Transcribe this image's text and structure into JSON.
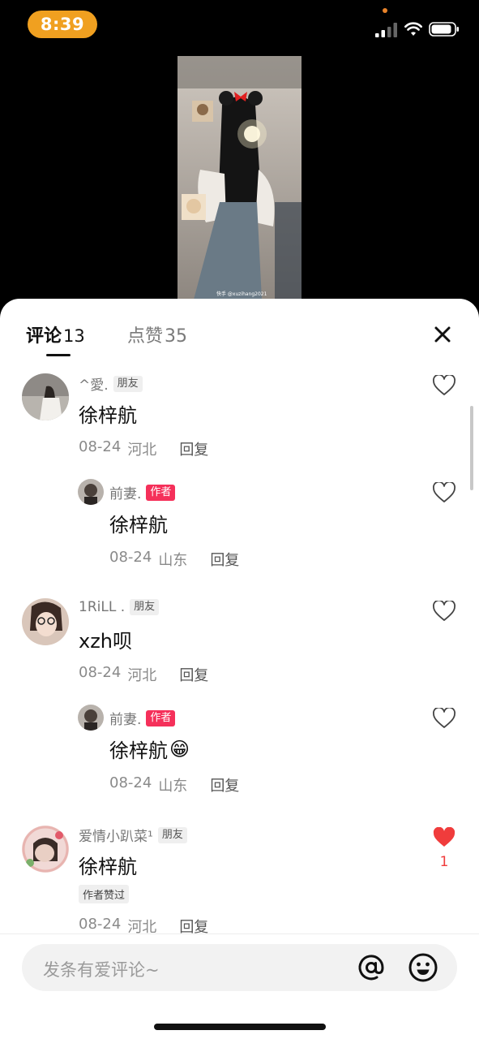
{
  "status_bar": {
    "time": "8:39"
  },
  "video": {
    "watermark": "快手 @xuzihang2021"
  },
  "tabs": {
    "comments_label": "评论",
    "comments_count": "13",
    "likes_label": "点赞",
    "likes_count": "35"
  },
  "comments": [
    {
      "user": "^愛.",
      "tag": "朋友",
      "text": "徐梓航",
      "date": "08-24",
      "location": "河北",
      "reply": "回复"
    },
    {
      "user": "前妻.",
      "tag": "作者",
      "text": "徐梓航",
      "date": "08-24",
      "location": "山东",
      "reply": "回复"
    },
    {
      "user": "1RiLL .",
      "tag": "朋友",
      "text": "xzh呗",
      "date": "08-24",
      "location": "河北",
      "reply": "回复"
    },
    {
      "user": "前妻.",
      "tag": "作者",
      "text": "徐梓航",
      "emoji": "😁",
      "date": "08-24",
      "location": "山东",
      "reply": "回复"
    },
    {
      "user": "爱情小趴菜¹",
      "tag": "朋友",
      "text": "徐梓航",
      "badge": "作者赞过",
      "like_count": "1",
      "date": "08-24",
      "location": "河北",
      "reply": "回复"
    }
  ],
  "input": {
    "placeholder": "发条有爱评论~"
  },
  "colors": {
    "accent": "#f03c3c",
    "author_tag": "#f5305a",
    "time_pill": "#f0a020"
  }
}
